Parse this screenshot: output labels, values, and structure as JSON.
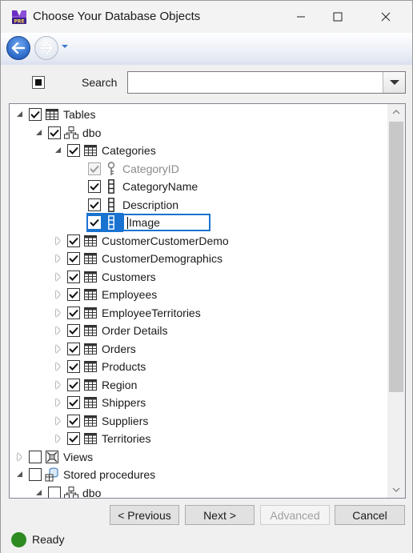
{
  "window": {
    "title": "Choose Your Database Objects"
  },
  "search": {
    "label": "Search",
    "value": ""
  },
  "tree": {
    "root_tables": "Tables",
    "schema_dbo": "dbo",
    "table_categories": "Categories",
    "columns": [
      "CategoryID",
      "CategoryName",
      "Description"
    ],
    "editing_column": "Image",
    "tables": [
      "CustomerCustomerDemo",
      "CustomerDemographics",
      "Customers",
      "Employees",
      "EmployeeTerritories",
      "Order Details",
      "Orders",
      "Products",
      "Region",
      "Shippers",
      "Suppliers",
      "Territories"
    ],
    "root_views": "Views",
    "root_procs": "Stored procedures",
    "procs_schema": "dbo"
  },
  "buttons": {
    "previous": "< Previous",
    "next": "Next >",
    "advanced": "Advanced",
    "cancel": "Cancel"
  },
  "status": {
    "text": "Ready",
    "color": "#2e8b22"
  },
  "colors": {
    "accent": "#1a73d1"
  }
}
